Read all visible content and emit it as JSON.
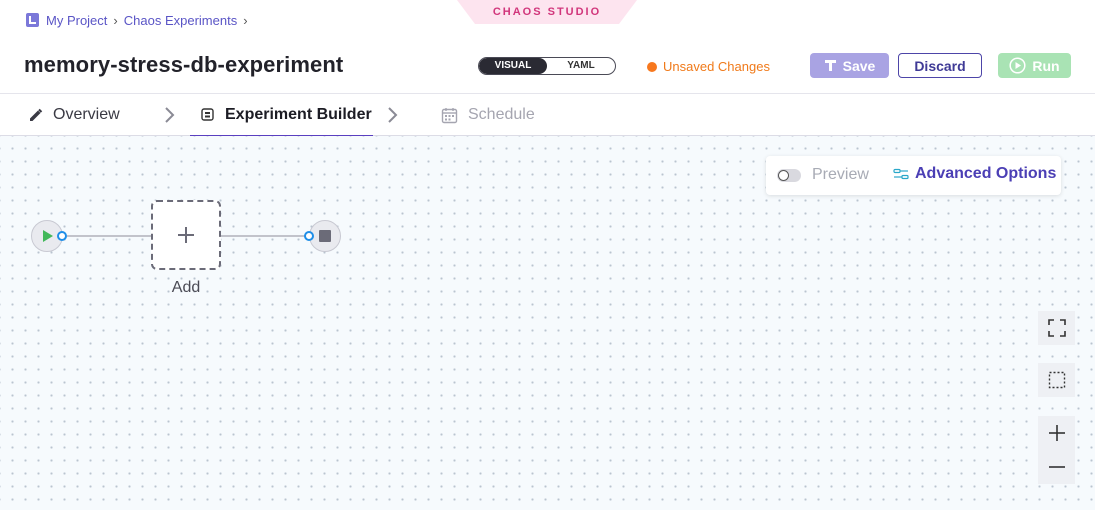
{
  "module_banner": "CHAOS STUDIO",
  "breadcrumb": [
    "My Project",
    "Chaos Experiments"
  ],
  "title": "memory-stress-db-experiment",
  "view_toggle": {
    "options": [
      "VISUAL",
      "YAML"
    ],
    "selected": "VISUAL"
  },
  "status": {
    "text": "Unsaved Changes",
    "color": "#f7781e"
  },
  "buttons": {
    "save": "Save",
    "discard": "Discard",
    "run": "Run"
  },
  "tabs": [
    {
      "label": "Overview",
      "icon": "pencil-icon",
      "active": false
    },
    {
      "label": "Experiment Builder",
      "icon": "builder-icon",
      "active": true
    },
    {
      "label": "Schedule",
      "icon": "calendar-icon",
      "active": false
    }
  ],
  "canvas": {
    "preview_label": "Preview",
    "advanced_label": "Advanced Options",
    "add_label": "Add"
  },
  "colors": {
    "accent": "#5a3fc0",
    "save": "#a9a3e3",
    "run": "#a9e3b4",
    "port": "#1e8ee8"
  }
}
